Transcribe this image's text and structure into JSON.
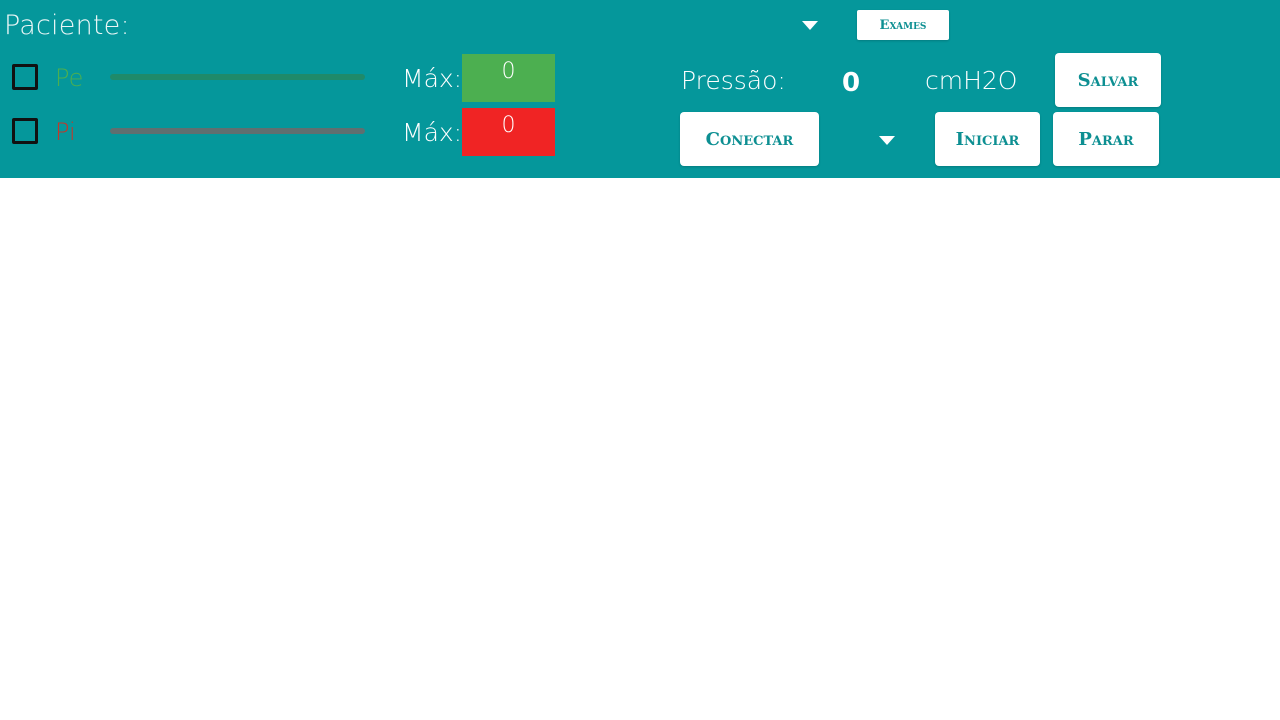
{
  "header": {
    "patient_label": "Paciente:",
    "exams_label": "Exames",
    "save_label": "Salvar",
    "connect_label": "Conectar",
    "start_label": "Iniciar",
    "stop_label": "Parar"
  },
  "signals": [
    {
      "label": "Pe",
      "color": "#4caf50",
      "slider_color": "#1f8a6a",
      "max_label": "Máx:",
      "max_value": "0",
      "max_bg": "#4caf50",
      "checked": false
    },
    {
      "label": "Pi",
      "color": "#c0392b",
      "slider_color": "#5f6f70",
      "max_label": "Máx:",
      "max_value": "0",
      "max_bg": "#f02424",
      "checked": false
    }
  ],
  "pressure": {
    "label": "Pressão:",
    "value": "0",
    "unit": "cmH2O"
  },
  "colors": {
    "topbar": "#05979b",
    "button_text": "#0d8f92"
  },
  "icons": {
    "patient_dropdown": "caret-down-icon",
    "port_dropdown": "caret-down-icon"
  }
}
